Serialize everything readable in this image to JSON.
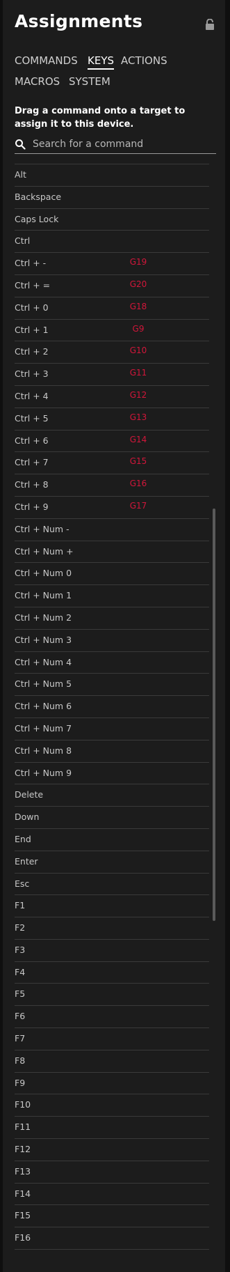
{
  "header": {
    "title": "Assignments",
    "lock_icon": "lock-icon"
  },
  "tabs": [
    {
      "label": "COMMANDS",
      "active": false
    },
    {
      "label": "KEYS",
      "active": true
    },
    {
      "label": "ACTIONS",
      "active": false
    },
    {
      "label": "MACROS",
      "active": false
    },
    {
      "label": "SYSTEM",
      "active": false
    }
  ],
  "instruction": "Drag a command onto a target to assign it to this device.",
  "search": {
    "placeholder": "Search for a command",
    "value": "",
    "icon": "search-icon"
  },
  "keys": [
    {
      "label": "Alt",
      "assignment": ""
    },
    {
      "label": "Backspace",
      "assignment": ""
    },
    {
      "label": "Caps Lock",
      "assignment": ""
    },
    {
      "label": "Ctrl",
      "assignment": ""
    },
    {
      "label": "Ctrl + -",
      "assignment": "G19"
    },
    {
      "label": "Ctrl + =",
      "assignment": "G20"
    },
    {
      "label": "Ctrl + 0",
      "assignment": "G18"
    },
    {
      "label": "Ctrl + 1",
      "assignment": "G9"
    },
    {
      "label": "Ctrl + 2",
      "assignment": "G10"
    },
    {
      "label": "Ctrl + 3",
      "assignment": "G11"
    },
    {
      "label": "Ctrl + 4",
      "assignment": "G12"
    },
    {
      "label": "Ctrl + 5",
      "assignment": "G13"
    },
    {
      "label": "Ctrl + 6",
      "assignment": "G14"
    },
    {
      "label": "Ctrl + 7",
      "assignment": "G15"
    },
    {
      "label": "Ctrl + 8",
      "assignment": "G16"
    },
    {
      "label": "Ctrl + 9",
      "assignment": "G17"
    },
    {
      "label": "Ctrl + Num -",
      "assignment": ""
    },
    {
      "label": "Ctrl + Num +",
      "assignment": ""
    },
    {
      "label": "Ctrl + Num 0",
      "assignment": ""
    },
    {
      "label": "Ctrl + Num 1",
      "assignment": ""
    },
    {
      "label": "Ctrl + Num 2",
      "assignment": ""
    },
    {
      "label": "Ctrl + Num 3",
      "assignment": ""
    },
    {
      "label": "Ctrl + Num 4",
      "assignment": ""
    },
    {
      "label": "Ctrl + Num 5",
      "assignment": ""
    },
    {
      "label": "Ctrl + Num 6",
      "assignment": ""
    },
    {
      "label": "Ctrl + Num 7",
      "assignment": ""
    },
    {
      "label": "Ctrl + Num 8",
      "assignment": ""
    },
    {
      "label": "Ctrl + Num 9",
      "assignment": ""
    },
    {
      "label": "Delete",
      "assignment": ""
    },
    {
      "label": "Down",
      "assignment": ""
    },
    {
      "label": "End",
      "assignment": ""
    },
    {
      "label": "Enter",
      "assignment": ""
    },
    {
      "label": "Esc",
      "assignment": ""
    },
    {
      "label": "F1",
      "assignment": ""
    },
    {
      "label": "F2",
      "assignment": ""
    },
    {
      "label": "F3",
      "assignment": ""
    },
    {
      "label": "F4",
      "assignment": ""
    },
    {
      "label": "F5",
      "assignment": ""
    },
    {
      "label": "F6",
      "assignment": ""
    },
    {
      "label": "F7",
      "assignment": ""
    },
    {
      "label": "F8",
      "assignment": ""
    },
    {
      "label": "F9",
      "assignment": ""
    },
    {
      "label": "F10",
      "assignment": ""
    },
    {
      "label": "F11",
      "assignment": ""
    },
    {
      "label": "F12",
      "assignment": ""
    },
    {
      "label": "F13",
      "assignment": ""
    },
    {
      "label": "F14",
      "assignment": ""
    },
    {
      "label": "F15",
      "assignment": ""
    },
    {
      "label": "F16",
      "assignment": ""
    }
  ],
  "colors": {
    "background": "#1c1c1c",
    "assignment": "#d2163a",
    "divider": "#3a3a3a"
  }
}
